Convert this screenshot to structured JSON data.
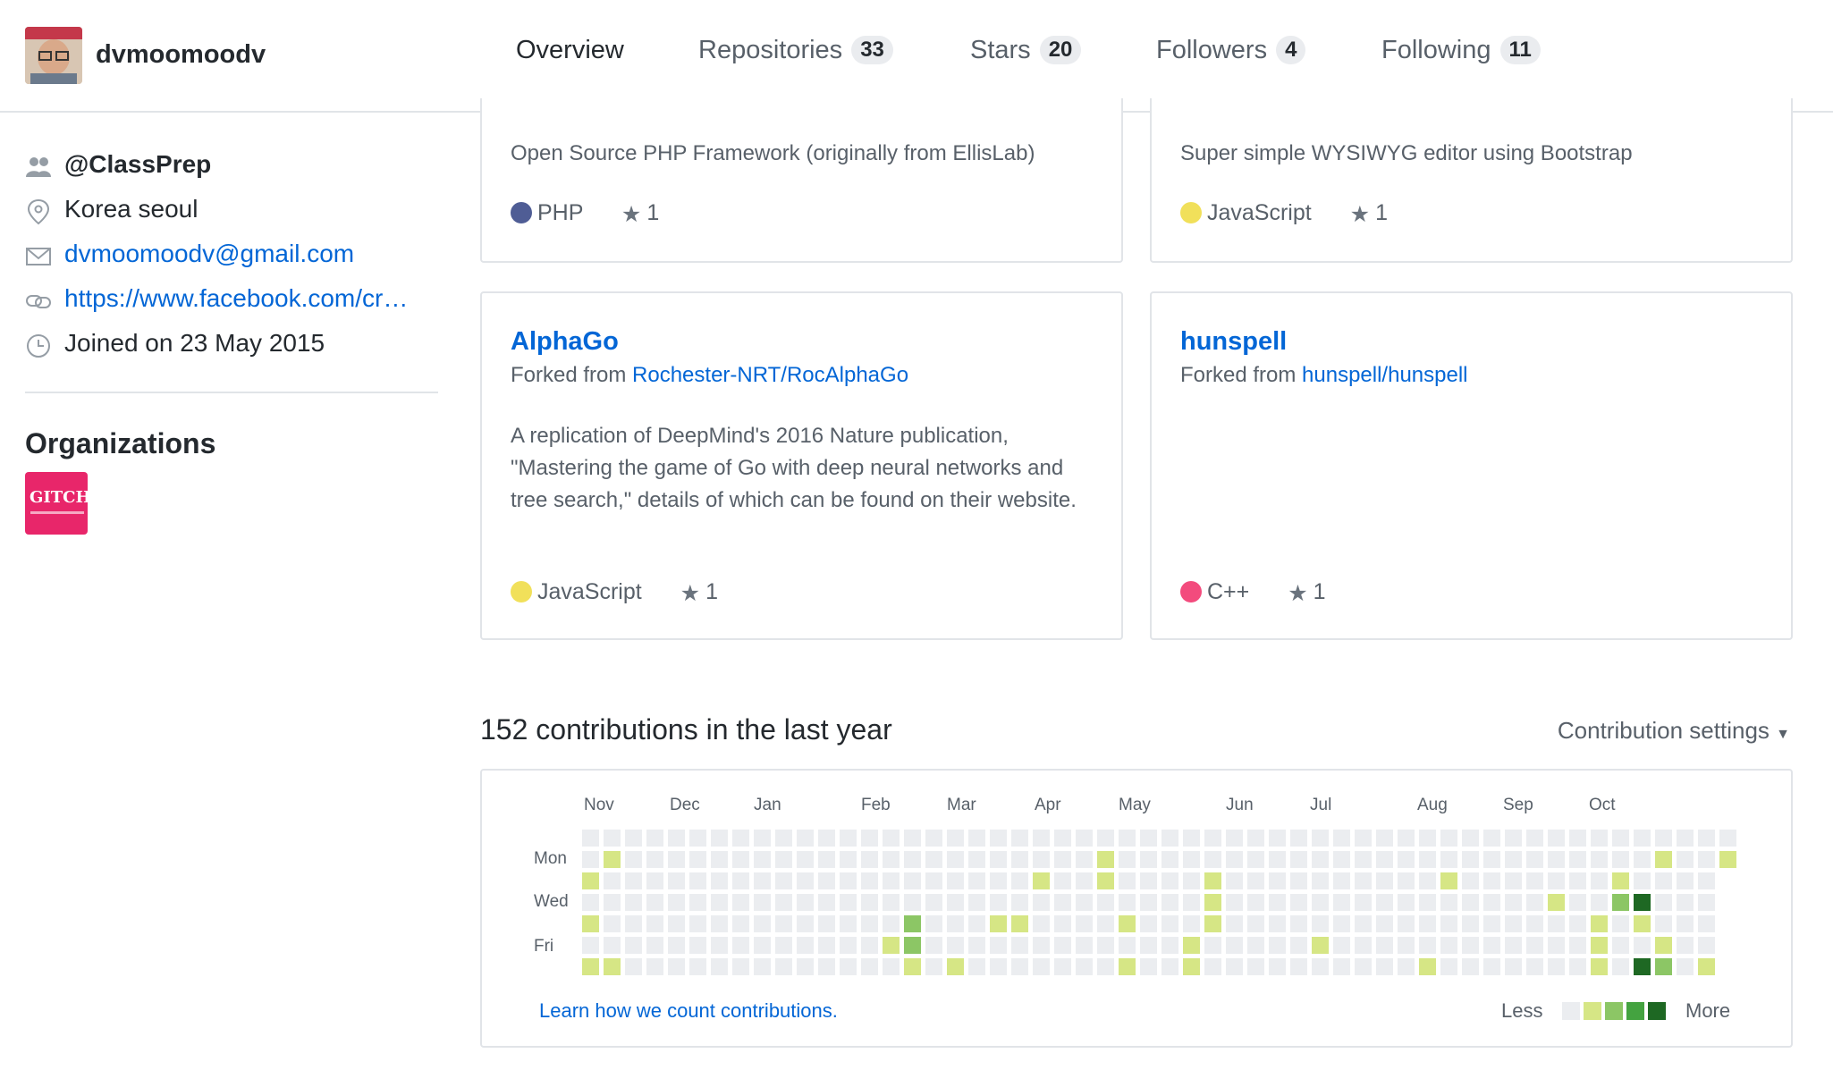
{
  "profile": {
    "username": "dvmoomoodv",
    "organization_handle": "@ClassPrep",
    "location": "Korea seoul",
    "email": "dvmoomoodv@gmail.com",
    "website": "https://www.facebook.com/cr…",
    "joined": "Joined on 23 May 2015"
  },
  "tabs": [
    {
      "label": "Overview",
      "count": ""
    },
    {
      "label": "Repositories",
      "count": "33"
    },
    {
      "label": "Stars",
      "count": "20"
    },
    {
      "label": "Followers",
      "count": "4"
    },
    {
      "label": "Following",
      "count": "11"
    }
  ],
  "sidebar": {
    "organizations_heading": "Organizations",
    "org_avatar_text": "GITCHA!"
  },
  "repos": [
    {
      "name": "",
      "description": "Open Source PHP Framework (originally from EllisLab)",
      "language": "PHP",
      "language_color": "#4F5D95",
      "stars": "1"
    },
    {
      "name": "",
      "description": "Super simple WYSIWYG editor using Bootstrap",
      "language": "JavaScript",
      "language_color": "#f1e05a",
      "stars": "1"
    },
    {
      "name": "AlphaGo",
      "forked_prefix": "Forked from ",
      "forked_from": "Rochester-NRT/RocAlphaGo",
      "description": "A replication of DeepMind's 2016 Nature publication, \"Mastering the game of Go with deep neural networks and tree search,\" details of which can be found on their website.",
      "language": "JavaScript",
      "language_color": "#f1e05a",
      "stars": "1"
    },
    {
      "name": "hunspell",
      "forked_prefix": "Forked from ",
      "forked_from": "hunspell/hunspell",
      "description": "",
      "language": "C++",
      "language_color": "#f34b7d",
      "stars": "1"
    }
  ],
  "contributions": {
    "title": "152 contributions in the last year",
    "settings_label": "Contribution settings",
    "months": [
      "Nov",
      "Dec",
      "Jan",
      "Feb",
      "Mar",
      "Apr",
      "May",
      "Jun",
      "Jul",
      "Aug",
      "Sep",
      "Oct"
    ],
    "day_labels": [
      "Mon",
      "Wed",
      "Fri"
    ],
    "learn_link": "Learn how we count contributions.",
    "legend_less": "Less",
    "legend_more": "More",
    "colors": [
      "#ebedf0",
      "#d6e685",
      "#8cc665",
      "#44a340",
      "#1e6823"
    ],
    "weeks": 54,
    "active_cells": [
      [
        0,
        2,
        1
      ],
      [
        0,
        4,
        1
      ],
      [
        0,
        6,
        1
      ],
      [
        1,
        1,
        1
      ],
      [
        1,
        6,
        1
      ],
      [
        14,
        5,
        1
      ],
      [
        15,
        4,
        2
      ],
      [
        15,
        5,
        2
      ],
      [
        15,
        6,
        1
      ],
      [
        17,
        6,
        1
      ],
      [
        19,
        4,
        1
      ],
      [
        20,
        4,
        1
      ],
      [
        21,
        2,
        1
      ],
      [
        24,
        1,
        1
      ],
      [
        24,
        2,
        1
      ],
      [
        24,
        7,
        1
      ],
      [
        25,
        4,
        1
      ],
      [
        25,
        6,
        1
      ],
      [
        28,
        5,
        1
      ],
      [
        28,
        6,
        1
      ],
      [
        29,
        2,
        1
      ],
      [
        29,
        3,
        1
      ],
      [
        29,
        4,
        1
      ],
      [
        34,
        5,
        1
      ],
      [
        39,
        6,
        1
      ],
      [
        40,
        2,
        1
      ],
      [
        45,
        3,
        1
      ],
      [
        47,
        4,
        1
      ],
      [
        47,
        5,
        1
      ],
      [
        47,
        6,
        1
      ],
      [
        48,
        2,
        1
      ],
      [
        48,
        3,
        2
      ],
      [
        49,
        3,
        4
      ],
      [
        49,
        4,
        1
      ],
      [
        49,
        6,
        4
      ],
      [
        50,
        1,
        1
      ],
      [
        50,
        5,
        1
      ],
      [
        50,
        6,
        2
      ],
      [
        52,
        6,
        1
      ],
      [
        52,
        7,
        1
      ],
      [
        53,
        1,
        1
      ]
    ]
  }
}
